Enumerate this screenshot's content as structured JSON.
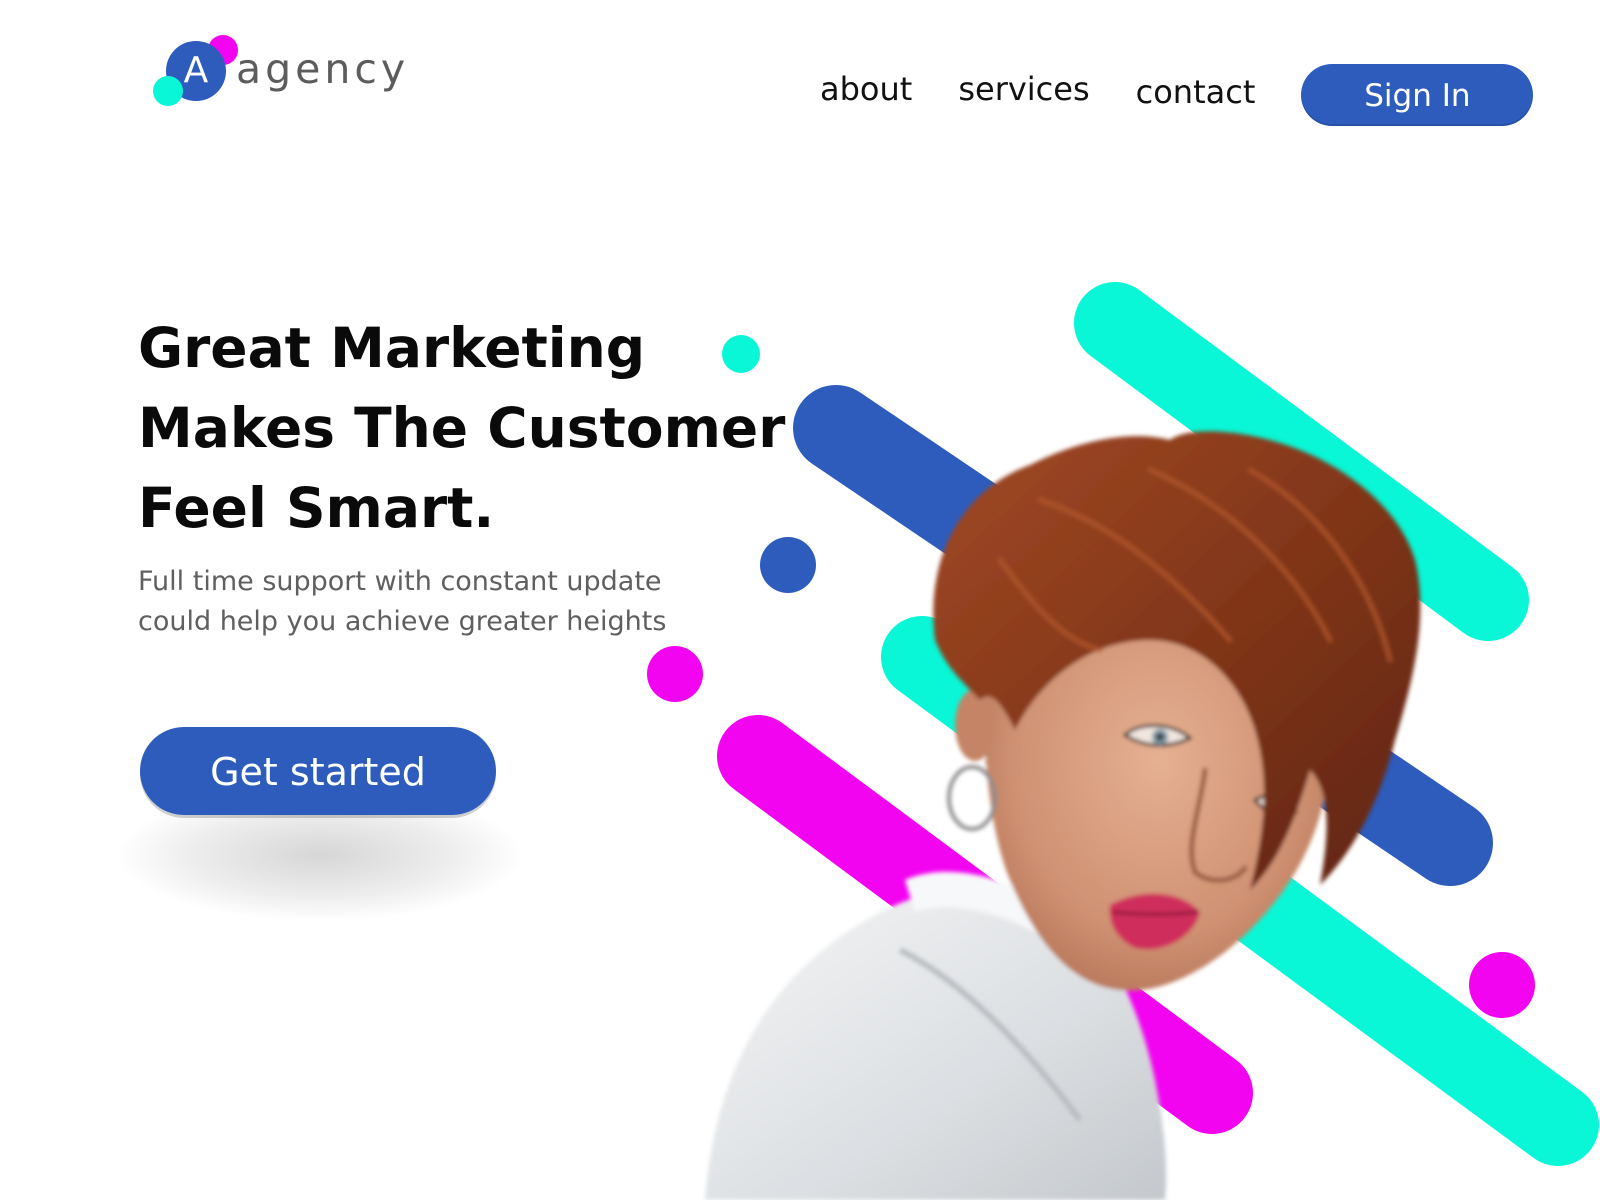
{
  "brand": {
    "logo_letter": "A",
    "name": "agency"
  },
  "nav": {
    "items": [
      {
        "label": "about"
      },
      {
        "label": "services"
      },
      {
        "label": "contact"
      }
    ],
    "signin_label": "Sign In"
  },
  "hero": {
    "title_lines": [
      "Great Marketing",
      "Makes The Customer",
      "Feel Smart."
    ],
    "subtitle_lines": [
      "Full time support with constant update",
      "could help you achieve greater heights"
    ],
    "cta_label": "Get started"
  },
  "colors": {
    "primary_blue": "#2d5cbd",
    "accent_cyan": "#09f7d7",
    "accent_magenta": "#f204f0",
    "hair": "#8a3d1f",
    "skin": "#d9a082",
    "shirt": "#e6e8ea",
    "lips": "#cf2f5b"
  },
  "icons": [
    "logo-mark-icon"
  ]
}
